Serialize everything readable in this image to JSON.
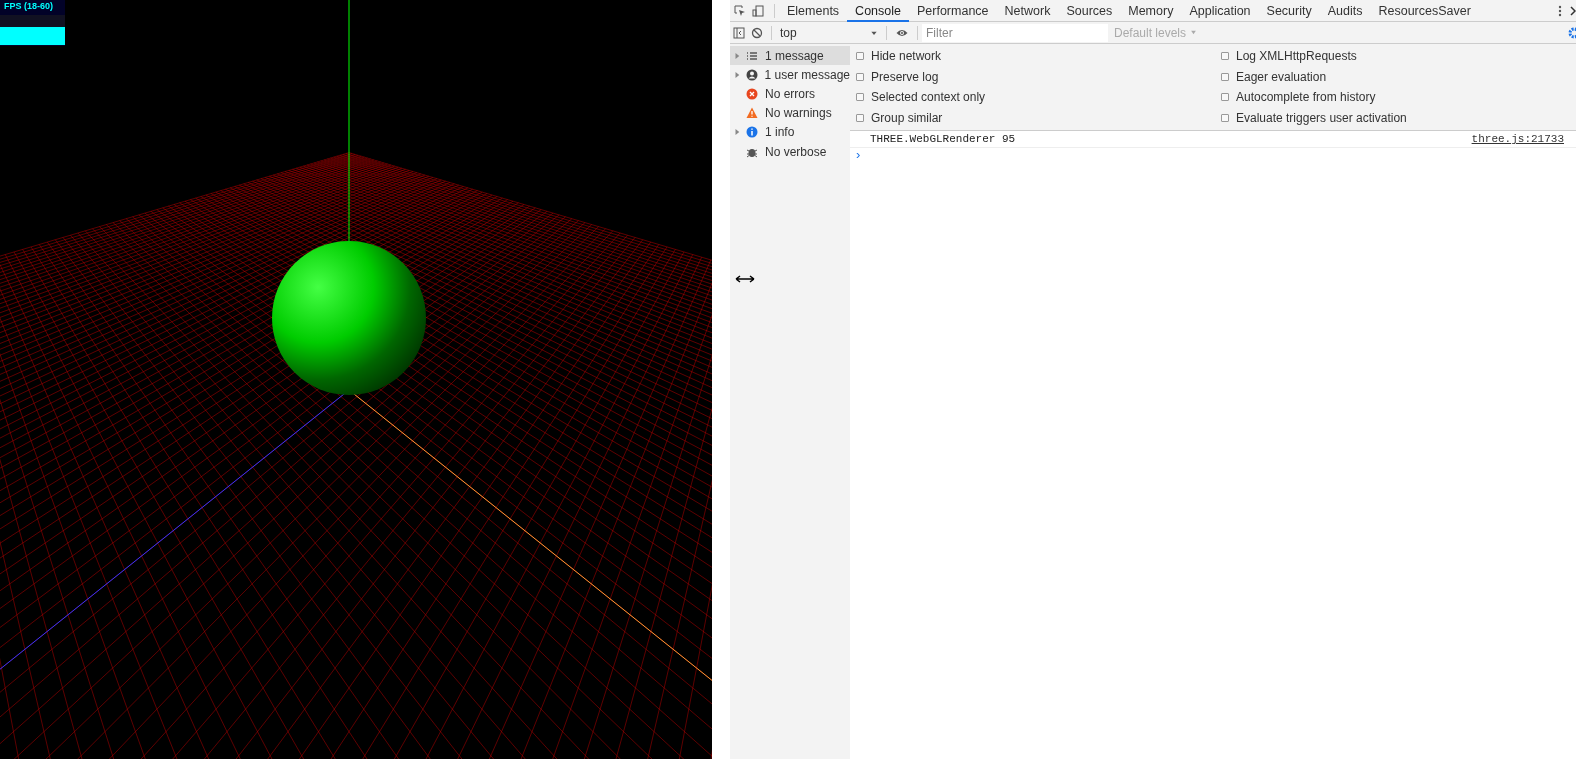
{
  "scene": {
    "fps_label": "FPS (18-60)"
  },
  "devtools": {
    "tabs": [
      {
        "label": "Elements",
        "selected": false
      },
      {
        "label": "Console",
        "selected": true
      },
      {
        "label": "Performance",
        "selected": false
      },
      {
        "label": "Network",
        "selected": false
      },
      {
        "label": "Sources",
        "selected": false
      },
      {
        "label": "Memory",
        "selected": false
      },
      {
        "label": "Application",
        "selected": false
      },
      {
        "label": "Security",
        "selected": false
      },
      {
        "label": "Audits",
        "selected": false
      },
      {
        "label": "ResourcesSaver",
        "selected": false
      }
    ],
    "context": "top",
    "filter_placeholder": "Filter",
    "levels": "Default levels",
    "sidebar": [
      {
        "label": "1 message",
        "kind": "list",
        "expandable": true,
        "selected": true
      },
      {
        "label": "1 user message",
        "kind": "user",
        "expandable": true,
        "selected": false
      },
      {
        "label": "No errors",
        "kind": "error",
        "expandable": false,
        "selected": false
      },
      {
        "label": "No warnings",
        "kind": "warning",
        "expandable": false,
        "selected": false
      },
      {
        "label": "1 info",
        "kind": "info",
        "expandable": true,
        "selected": false
      },
      {
        "label": "No verbose",
        "kind": "verbose",
        "expandable": false,
        "selected": false
      }
    ],
    "settings": [
      {
        "label": "Hide network",
        "checked": false
      },
      {
        "label": "Preserve log",
        "checked": false
      },
      {
        "label": "Selected context only",
        "checked": false
      },
      {
        "label": "Group similar",
        "checked": false
      },
      {
        "label": "Log XMLHttpRequests",
        "checked": false
      },
      {
        "label": "Eager evaluation",
        "checked": false
      },
      {
        "label": "Autocomplete from history",
        "checked": false
      },
      {
        "label": "Evaluate triggers user activation",
        "checked": false
      }
    ],
    "messages": [
      {
        "text": "THREE.WebGLRenderer 95",
        "source": "three.js:21733"
      }
    ],
    "prompt": "›"
  }
}
